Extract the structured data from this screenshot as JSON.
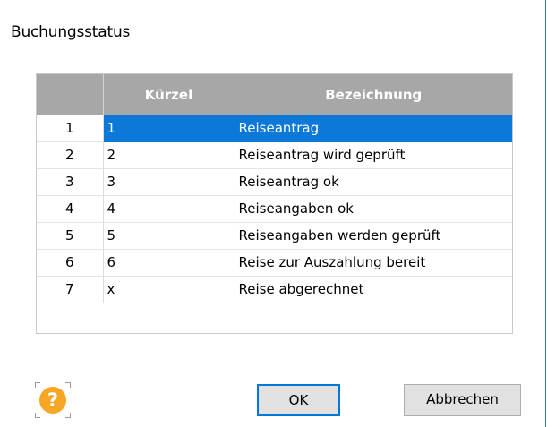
{
  "window": {
    "title": "Buchungsstatus"
  },
  "table": {
    "columns": [
      "",
      "Kürzel",
      "Bezeichnung"
    ],
    "rows": [
      {
        "num": "1",
        "code": "1",
        "desc": "Reiseantrag",
        "selected": true
      },
      {
        "num": "2",
        "code": "2",
        "desc": "Reiseantrag wird geprüft"
      },
      {
        "num": "3",
        "code": "3",
        "desc": "Reiseantrag ok"
      },
      {
        "num": "4",
        "code": "4",
        "desc": "Reiseangaben ok"
      },
      {
        "num": "5",
        "code": "5",
        "desc": "Reiseangaben werden geprüft"
      },
      {
        "num": "6",
        "code": "6",
        "desc": "Reise zur Auszahlung bereit"
      },
      {
        "num": "7",
        "code": "x",
        "desc": "Reise abgerechnet"
      }
    ]
  },
  "buttons": {
    "ok_mnemonic": "O",
    "ok_rest": "K",
    "cancel": "Abbrechen"
  },
  "help": {
    "glyph": "?",
    "icon": "help-question-icon"
  },
  "colors": {
    "selection": "#0c78d7",
    "header": "#a7a7a7",
    "help": "#f5a623",
    "focus": "#0078d7"
  }
}
